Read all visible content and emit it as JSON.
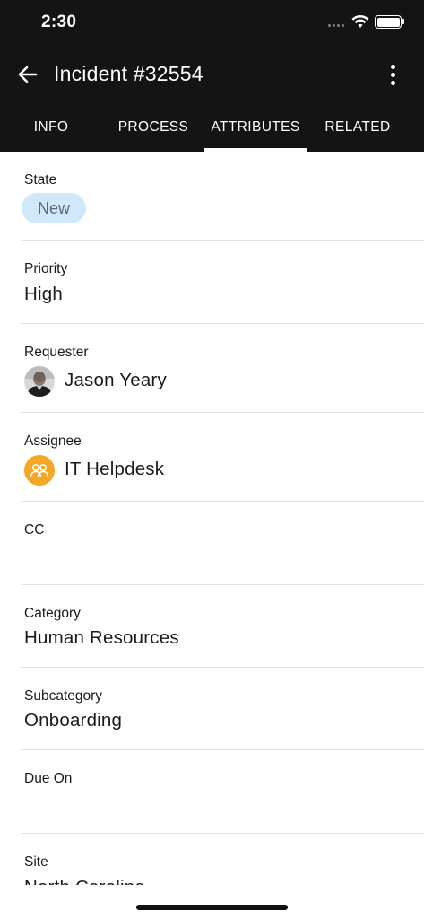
{
  "status_bar": {
    "time": "2:30"
  },
  "toolbar": {
    "title": "Incident #32554",
    "back_icon": "arrow-left-icon",
    "more_icon": "more-vertical-icon"
  },
  "tabs": [
    {
      "label": "INFO",
      "active": false
    },
    {
      "label": "PROCESS",
      "active": false
    },
    {
      "label": "ATTRIBUTES",
      "active": true
    },
    {
      "label": "RELATED",
      "active": false
    }
  ],
  "fields": {
    "state": {
      "label": "State",
      "value": "New"
    },
    "priority": {
      "label": "Priority",
      "value": "High"
    },
    "requester": {
      "label": "Requester",
      "value": "Jason Yeary"
    },
    "assignee": {
      "label": "Assignee",
      "value": "IT Helpdesk"
    },
    "cc": {
      "label": "CC",
      "value": ""
    },
    "category": {
      "label": "Category",
      "value": "Human Resources"
    },
    "subcategory": {
      "label": "Subcategory",
      "value": "Onboarding"
    },
    "due_on": {
      "label": "Due On",
      "value": ""
    },
    "site": {
      "label": "Site",
      "value": "North Carolina"
    }
  },
  "colors": {
    "header_bg": "#141414",
    "state_chip_bg": "#cfe9fb",
    "assignee_icon_bg": "#f5a623",
    "divider": "#e3e3e3"
  }
}
